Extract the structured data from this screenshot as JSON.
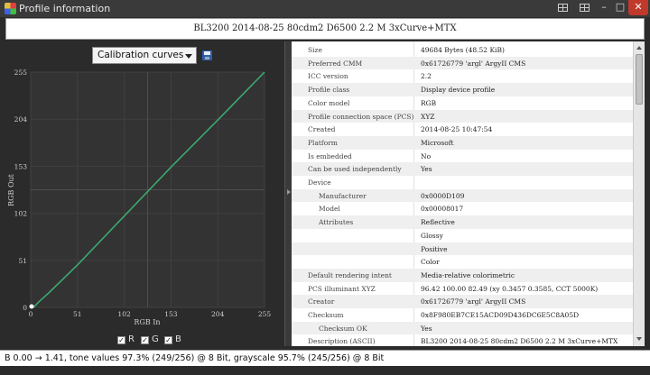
{
  "window": {
    "title": "Profile information"
  },
  "header": {
    "profile_name": "BL3200 2014-08-25 80cdm2 D6500 2.2 M 3xCurve+MTX"
  },
  "controls": {
    "view_select": "Calibration curves"
  },
  "chart_data": {
    "type": "line",
    "xlabel": "RGB In",
    "ylabel": "RGB Out",
    "xlim": [
      0,
      255
    ],
    "ylim": [
      0,
      255
    ],
    "x_ticks": [
      0,
      51,
      102,
      153,
      204,
      255
    ],
    "y_ticks": [
      0,
      51,
      102,
      153,
      204,
      255
    ],
    "grid": true,
    "crosshair": 127.5,
    "series": [
      {
        "color": "#3ca870",
        "x": [
          0,
          3,
          10,
          20,
          51,
          102,
          153,
          204,
          255
        ],
        "y": [
          0,
          0,
          7,
          16,
          46,
          99,
          152,
          203,
          255
        ]
      }
    ]
  },
  "channels": [
    {
      "label": "R",
      "checked": true
    },
    {
      "label": "G",
      "checked": true
    },
    {
      "label": "B",
      "checked": true
    }
  ],
  "profile_info": [
    {
      "key": "Size",
      "value": "49684 Bytes (48.52 KiB)"
    },
    {
      "key": "Preferred CMM",
      "value": "0x61726779 'argl' ArgyII CMS"
    },
    {
      "key": "ICC version",
      "value": "2.2"
    },
    {
      "key": "Profile class",
      "value": "Display device profile"
    },
    {
      "key": "Color model",
      "value": "RGB"
    },
    {
      "key": "Profile connection space (PCS)",
      "value": "XYZ"
    },
    {
      "key": "Created",
      "value": "2014-08-25 10:47:54"
    },
    {
      "key": "Platform",
      "value": "Microsoft"
    },
    {
      "key": "Is embedded",
      "value": "No"
    },
    {
      "key": "Can be used independently",
      "value": "Yes"
    },
    {
      "key": "Device",
      "value": ""
    },
    {
      "key": "Manufacturer",
      "value": "0x0000D109",
      "indent": true
    },
    {
      "key": "Model",
      "value": "0x00008017",
      "indent": true
    },
    {
      "key": "Attributes",
      "value": "Reflective",
      "indent": true
    },
    {
      "key": "",
      "value": "Glossy",
      "indent": true
    },
    {
      "key": "",
      "value": "Positive",
      "indent": true
    },
    {
      "key": "",
      "value": "Color",
      "indent": true
    },
    {
      "key": "Default rendering intent",
      "value": "Media-relative colorimetric"
    },
    {
      "key": "PCS illuminant XYZ",
      "value": "96.42 100.00  82.49 (xy 0.3457 0.3585, CCT 5000K)"
    },
    {
      "key": "Creator",
      "value": "0x61726779 'argl' ArgyII CMS"
    },
    {
      "key": "Checksum",
      "value": "0x8F980EB7CE15ACD09D436DC6E5C8A05D"
    },
    {
      "key": "Checksum OK",
      "value": "Yes",
      "indent": true
    },
    {
      "key": "Description (ASCII)",
      "value": "BL3200 2014-08-25 80cdm2 D6500 2.2 M 3xCurve+MTX"
    }
  ],
  "status": {
    "text": "B 0.00 → 1.41, tone values 97.3% (249/256) @ 8 Bit, grayscale 95.7% (245/256) @ 8 Bit"
  }
}
